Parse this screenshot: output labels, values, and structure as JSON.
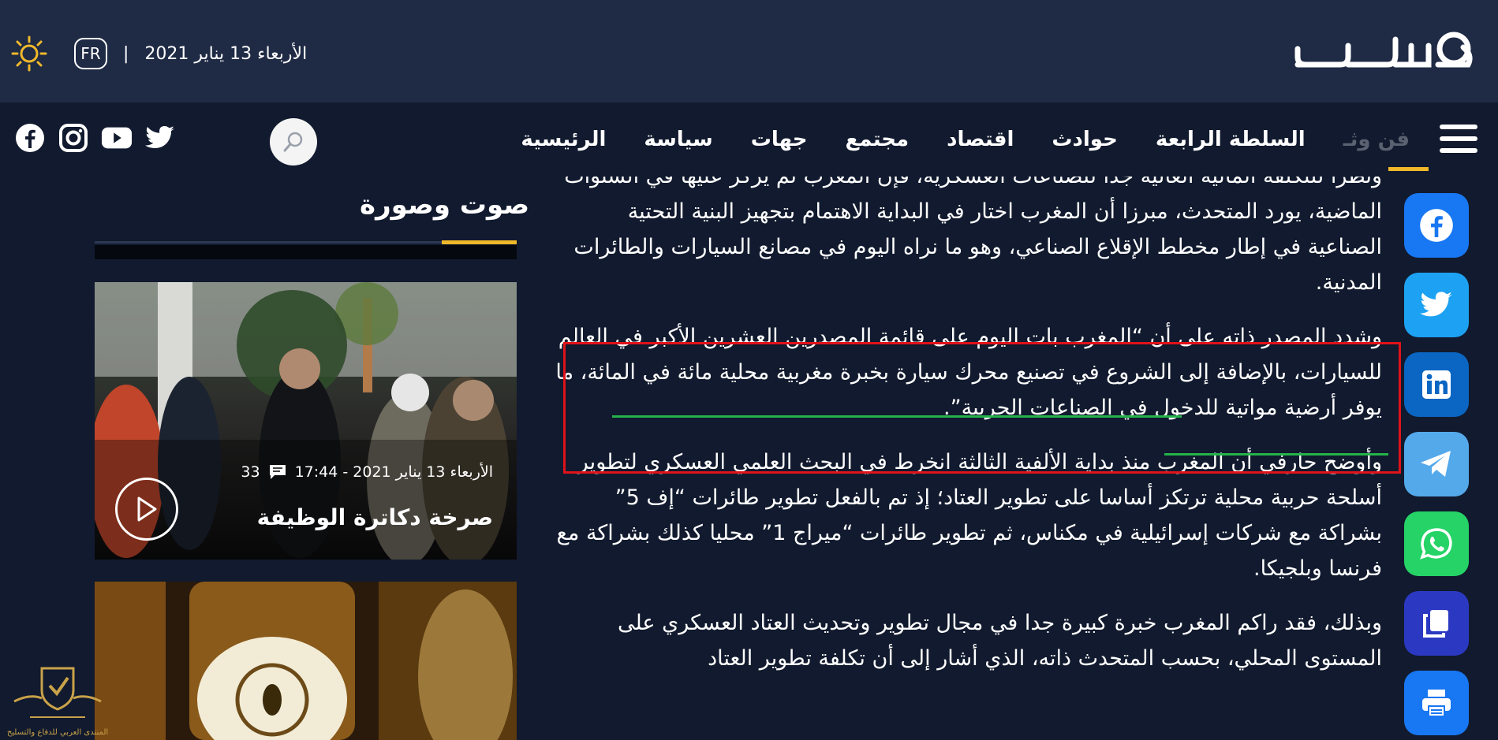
{
  "header": {
    "logo_alt": "هسبريس",
    "date": "الأربعاء 13 يناير 2021",
    "separator": "|",
    "lang_button": "FR",
    "theme_icon": "sun-icon"
  },
  "nav": {
    "items": [
      {
        "label": "الرئيسية"
      },
      {
        "label": "سياسة"
      },
      {
        "label": "جهات"
      },
      {
        "label": "مجتمع"
      },
      {
        "label": "اقتصاد"
      },
      {
        "label": "حوادث"
      },
      {
        "label": "السلطة الرابعة"
      },
      {
        "label": "فن وثـ"
      }
    ],
    "search_icon": "search-icon",
    "social": [
      "twitter-icon",
      "youtube-icon",
      "instagram-icon",
      "facebook-icon"
    ],
    "accent_color": "#f1b82a"
  },
  "article": {
    "paragraphs": [
      "ونظرا للتكلفة المالية العالية جدا للصناعات العسكرية، فإن المغرب لم يركز عليها في السنوات الماضية، يورد المتحدث، مبرزا أن المغرب اختار في البداية الاهتمام بتجهيز البنية التحتية الصناعية في إطار مخطط الإقلاع الصناعي، وهو ما نراه اليوم في مصانع السيارات والطائرات المدنية.",
      "وشدد المصدر ذاته على أن “المغرب بات اليوم على قائمة المصدرين العشرين الأكبر في العالم للسيارات، بالإضافة إلى الشروع في تصنيع محرك سيارة بخبرة مغربية محلية مائة في المائة، ما يوفر أرضية مواتية للدخول في الصناعات الحربية”.",
      "وأوضح حارفي أن المغرب منذ بداية الألفية الثالثة انخرط في البحث العلمي العسكري لتطوير أسلحة حربية محلية ترتكز أساسا على تطوير العتاد؛ إذ تم بالفعل تطوير طائرات “إف 5” بشراكة مع شركات إسرائيلية في مكناس، ثم تطوير طائرات “ميراج 1” محليا كذلك بشراكة مع فرنسا وبلجيكا.",
      "وبذلك، فقد راكم المغرب خبرة كبيرة جدا في مجال تطوير وتحديث العتاد العسكري على المستوى المحلي، بحسب المتحدث ذاته، الذي أشار إلى أن تكلفة تطوير العتاد"
    ],
    "highlight_color": "#e0121a",
    "underline_color": "#24b34a"
  },
  "share": {
    "buttons": [
      {
        "icon": "facebook-icon",
        "color": "#1877f2"
      },
      {
        "icon": "twitter-icon",
        "color": "#1da1f2"
      },
      {
        "icon": "linkedin-icon",
        "color": "#0a66c2"
      },
      {
        "icon": "telegram-icon",
        "color": "#54a9eb"
      },
      {
        "icon": "whatsapp-icon",
        "color": "#25d366"
      },
      {
        "icon": "copy-icon",
        "color": "#2b39c2"
      },
      {
        "icon": "print-icon",
        "color": "#1877f2"
      }
    ]
  },
  "sidebar": {
    "title": "صوت وصورة",
    "cards": [
      {
        "meta_date": "الأربعاء 13 يناير 2021 - 17:44",
        "comments": "33",
        "title": "صرخة دكاترة الوظيفة",
        "play_icon": "play-icon"
      },
      {
        "image": "honey-jar-photo"
      }
    ]
  },
  "watermark": {
    "text": "المنتدى العربي للدفاع والتسليح"
  }
}
